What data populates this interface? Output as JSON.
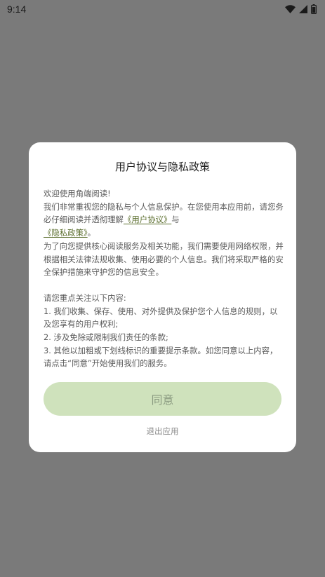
{
  "status_bar": {
    "time": "9:14",
    "icons": [
      "wifi-icon",
      "cellular-signal-icon",
      "battery-icon"
    ]
  },
  "dialog": {
    "title": "用户协议与隐私政策",
    "line_welcome": "欢迎使用角端阅读!",
    "para1_before": "我们非常重视您的隐私与个人信息保护。在您使用本应用前，请您务必仔细阅读并透彻理解",
    "user_agreement_link": "《用户协议》",
    "para1_and": "与",
    "privacy_policy_link": "《隐私政策》",
    "para1_end": "。",
    "para2": "为了向您提供核心阅读服务及相关功能，我们需要使用网络权限，并根据相关法律法规收集、使用必要的个人信息。我们将采取严格的安全保护措施来守护您的信息安全。",
    "focus_intro": "请您重点关注以下内容:",
    "focus_items": [
      "1. 我们收集、保存、使用、对外提供及保护您个人信息的规则，以及您享有的用户权利;",
      "2. 涉及免除或限制我们责任的条款;",
      "3. 其他以加粗或下划线标识的重要提示条款。如您同意以上内容，请点击“同意”开始使用我们的服务。"
    ],
    "agree_label": "同意",
    "exit_label": "退出应用"
  },
  "colors": {
    "overlay": "#7a7a7a",
    "dialog_bg": "#ffffff",
    "agree_button_bg": "#cfe2bc",
    "agree_button_text": "#8a9a80",
    "link": "#5b6e2d"
  }
}
